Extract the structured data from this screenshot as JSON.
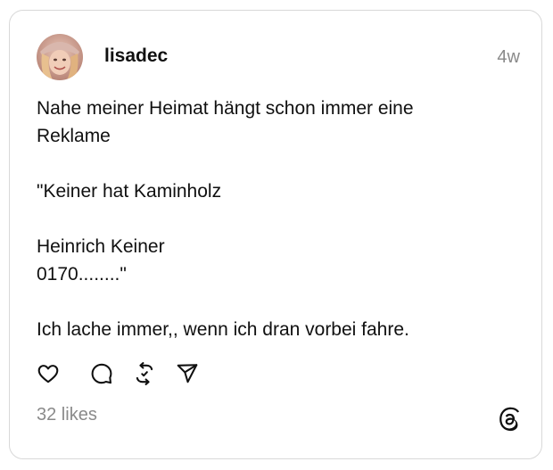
{
  "post": {
    "username": "lisadec",
    "timestamp": "4w",
    "lines": [
      "Nahe meiner Heimat hängt schon immer eine",
      "Reklame",
      "",
      "\"Keiner hat Kaminholz",
      "",
      "Heinrich Keiner",
      "0170........\"",
      "",
      "Ich lache immer,, wenn ich dran vorbei fahre."
    ],
    "likes": "32 likes"
  },
  "icons": {
    "like": "heart-icon",
    "comment": "speech-bubble-icon",
    "repost": "repost-arrows-icon",
    "share": "send-paper-plane-icon",
    "brand": "threads-logo-icon"
  },
  "colors": {
    "text": "#101010",
    "muted": "#8a8a8a",
    "border": "#d8d8d8"
  }
}
